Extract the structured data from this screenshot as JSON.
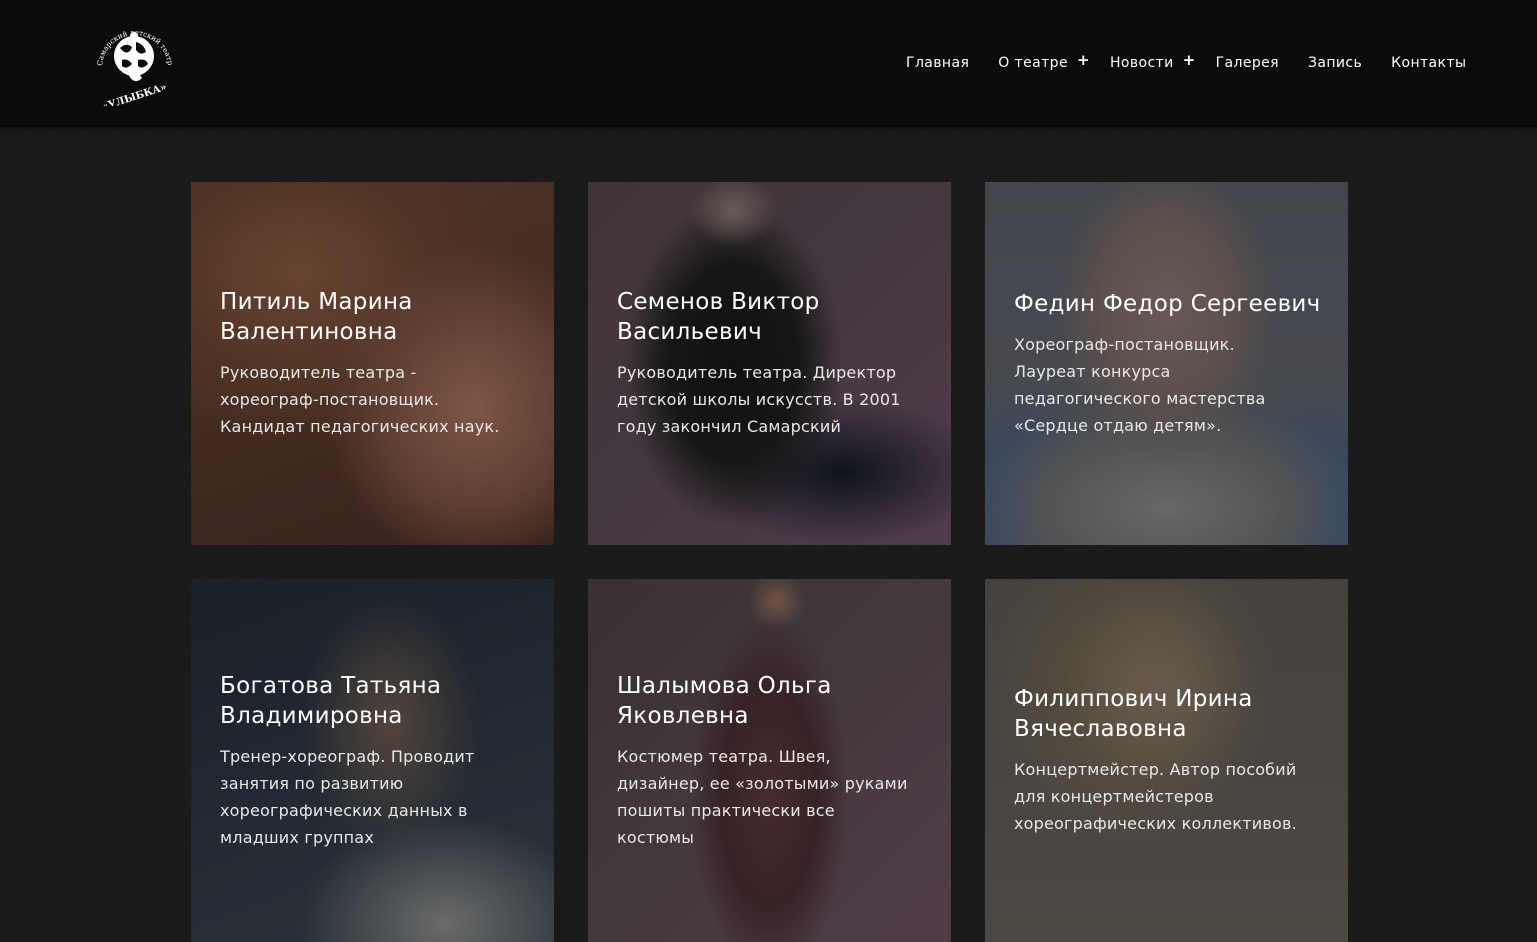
{
  "logo": {
    "arc_text": "Самарский детский театр танца",
    "name": "«УЛЫБКА»"
  },
  "nav": [
    {
      "label": "Главная",
      "has_submenu": false
    },
    {
      "label": "О театре",
      "has_submenu": true
    },
    {
      "label": "Новости",
      "has_submenu": true
    },
    {
      "label": "Галерея",
      "has_submenu": false
    },
    {
      "label": "Запись",
      "has_submenu": false
    },
    {
      "label": "Контакты",
      "has_submenu": false
    }
  ],
  "nav_plus": "+",
  "team": [
    {
      "name": "Питиль Марина Валентиновна",
      "description": "Руководитель театра - хореограф-постановщик. Кандидат педагогических наук."
    },
    {
      "name": "Семенов Виктор Васильевич",
      "description": "Руководитель театра. Директор детской школы искусств. В 2001 году закончил Самарский"
    },
    {
      "name": "Федин Федор Сергеевич",
      "description": "Хореограф-постановщик. Лауреат конкурса педагогического мастерства «Сердце отдаю детям»."
    },
    {
      "name": "Богатова Татьяна Владимировна",
      "description": "Тренер-хореограф. Проводит занятия по развитию хореографических данных в младших группах"
    },
    {
      "name": "Шалымова Ольга Яковлевна",
      "description": "Костюмер театра. Швея, дизайнер, ее «золотыми» руками пошиты практически все костюмы"
    },
    {
      "name": "Филиппович Ирина Вячеславовна",
      "description": "Концертмейстер. Автор пособий для концертмейстеров хореографических коллективов."
    }
  ],
  "colors": {
    "header_bg": "#0b0b0b",
    "page_bg": "#1a1a1a",
    "text": "#ffffff"
  }
}
